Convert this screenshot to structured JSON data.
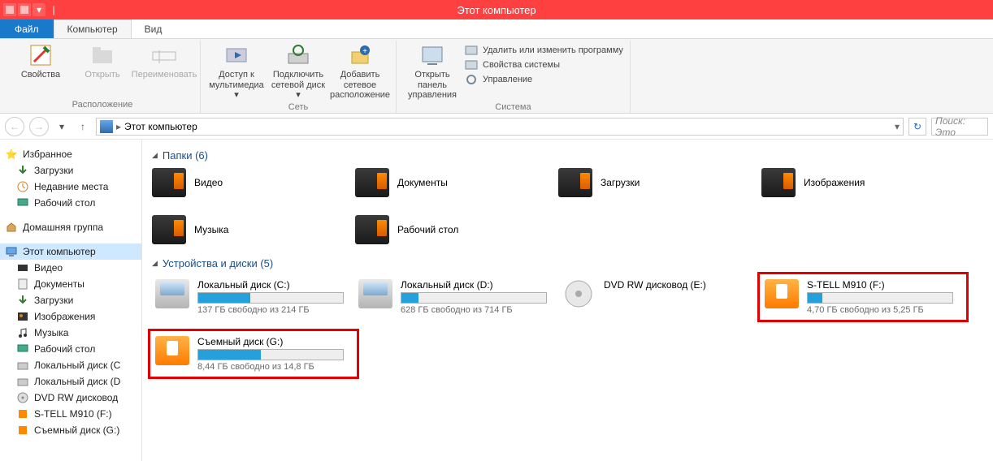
{
  "window": {
    "title": "Этот компьютер"
  },
  "menubar": {
    "file": "Файл",
    "tabs": [
      "Компьютер",
      "Вид"
    ],
    "active": 0
  },
  "ribbon": {
    "groups": [
      {
        "label": "Расположение",
        "buttons": [
          {
            "label": "Свойства",
            "icon": "properties"
          },
          {
            "label": "Открыть",
            "icon": "open",
            "disabled": true
          },
          {
            "label": "Переименовать",
            "icon": "rename",
            "disabled": true
          }
        ]
      },
      {
        "label": "Сеть",
        "buttons": [
          {
            "label": "Доступ к мультимедиа ▾",
            "icon": "media"
          },
          {
            "label": "Подключить сетевой диск ▾",
            "icon": "mapdrive"
          },
          {
            "label": "Добавить сетевое расположение",
            "icon": "addnet"
          }
        ]
      },
      {
        "label": "Система",
        "buttons": [
          {
            "label": "Открыть панель управления",
            "icon": "cpanel"
          }
        ],
        "small": [
          {
            "label": "Удалить или изменить программу",
            "icon": "uninstall"
          },
          {
            "label": "Свойства системы",
            "icon": "sysprops"
          },
          {
            "label": "Управление",
            "icon": "manage"
          }
        ]
      }
    ]
  },
  "nav": {
    "breadcrumb": "Этот компьютер",
    "search_placeholder": "Поиск: Это"
  },
  "sidebar": {
    "groups": [
      {
        "head": {
          "label": "Избранное",
          "icon": "star"
        },
        "items": [
          {
            "label": "Загрузки",
            "icon": "downloads"
          },
          {
            "label": "Недавние места",
            "icon": "recent"
          },
          {
            "label": "Рабочий стол",
            "icon": "desktop"
          }
        ]
      },
      {
        "head": {
          "label": "Домашняя группа",
          "icon": "homegroup"
        },
        "items": []
      },
      {
        "head": {
          "label": "Этот компьютер",
          "icon": "computer",
          "selected": true
        },
        "items": [
          {
            "label": "Видео",
            "icon": "video"
          },
          {
            "label": "Документы",
            "icon": "docs"
          },
          {
            "label": "Загрузки",
            "icon": "downloads"
          },
          {
            "label": "Изображения",
            "icon": "images"
          },
          {
            "label": "Музыка",
            "icon": "music"
          },
          {
            "label": "Рабочий стол",
            "icon": "desktop"
          },
          {
            "label": "Локальный диск (C",
            "icon": "hdd"
          },
          {
            "label": "Локальный диск (D",
            "icon": "hdd"
          },
          {
            "label": "DVD RW дисковод",
            "icon": "dvd"
          },
          {
            "label": "S-TELL M910 (F:)",
            "icon": "usb"
          },
          {
            "label": "Съемный диск (G:)",
            "icon": "usb"
          }
        ]
      }
    ]
  },
  "content": {
    "folders": {
      "heading": "Папки (6)",
      "items": [
        "Видео",
        "Документы",
        "Загрузки",
        "Изображения",
        "Музыка",
        "Рабочий стол"
      ]
    },
    "drives": {
      "heading": "Устройства и диски (5)",
      "items": [
        {
          "name": "Локальный диск (C:)",
          "sub": "137 ГБ свободно из 214 ГБ",
          "fill": 36,
          "type": "hdd",
          "hl": false
        },
        {
          "name": "Локальный диск (D:)",
          "sub": "628 ГБ свободно из 714 ГБ",
          "fill": 12,
          "type": "hdd",
          "hl": false
        },
        {
          "name": "DVD RW дисковод (E:)",
          "sub": "",
          "fill": null,
          "type": "dvd",
          "hl": false
        },
        {
          "name": "S-TELL M910 (F:)",
          "sub": "4,70 ГБ свободно из 5,25 ГБ",
          "fill": 10,
          "type": "usb",
          "hl": true
        },
        {
          "name": "Съемный диск (G:)",
          "sub": "8,44 ГБ свободно из 14,8 ГБ",
          "fill": 43,
          "type": "usb",
          "hl": true
        }
      ]
    }
  }
}
